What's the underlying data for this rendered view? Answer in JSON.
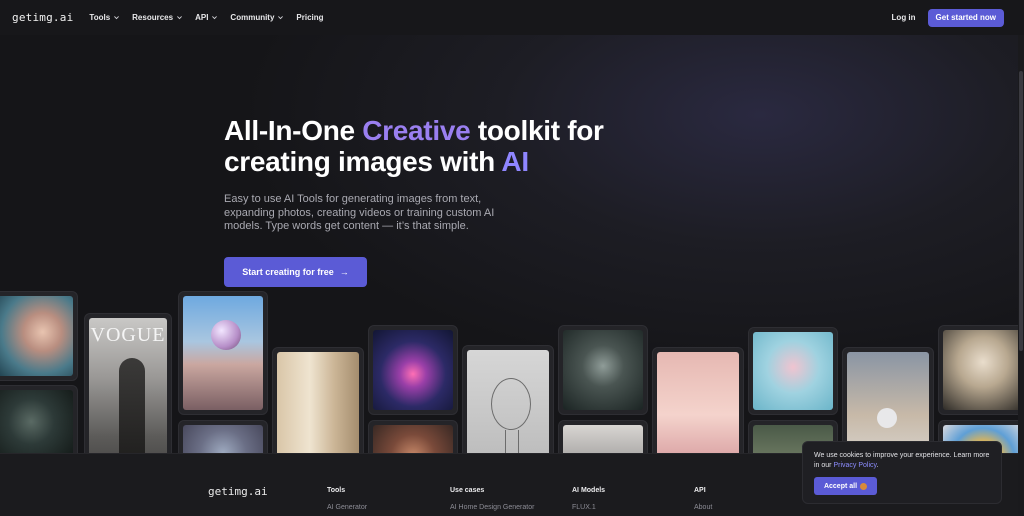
{
  "nav": {
    "logo": "getimg.ai",
    "links": [
      {
        "label": "Tools",
        "has_dropdown": true
      },
      {
        "label": "Resources",
        "has_dropdown": true
      },
      {
        "label": "API",
        "has_dropdown": true
      },
      {
        "label": "Community",
        "has_dropdown": true
      },
      {
        "label": "Pricing",
        "has_dropdown": false
      }
    ],
    "login": "Log in",
    "get_started": "Get started now"
  },
  "hero": {
    "headline_pre": "All-In-One ",
    "headline_accent": "Creative",
    "headline_mid": " toolkit for",
    "headline_line2_pre": "creating images with ",
    "headline_line2_accent": "AI",
    "subtitle": "Easy to use AI Tools for generating images from text, expanding photos, creating videos or training custom AI models. Type words get content — it’s that simple.",
    "cta_label": "Start creating for free",
    "cta_arrow": "→"
  },
  "gallery": {
    "vogue_label": "VOGUE"
  },
  "footer": {
    "logo": "getimg.ai",
    "columns": [
      {
        "heading": "Tools",
        "first_item": "AI Generator"
      },
      {
        "heading": "Use cases",
        "first_item": "AI Home Design Generator"
      },
      {
        "heading": "AI Models",
        "first_item": "FLUX.1"
      },
      {
        "heading": "API",
        "first_item": "About"
      }
    ]
  },
  "cookie": {
    "text_pre": "We use cookies to improve your experience. Learn more in our ",
    "link": "Privacy Policy",
    "text_post": ".",
    "accept": "Accept all"
  },
  "colors": {
    "accent": "#5b5bd6",
    "gradient_text": "#9a7ff0",
    "background": "#141416"
  }
}
